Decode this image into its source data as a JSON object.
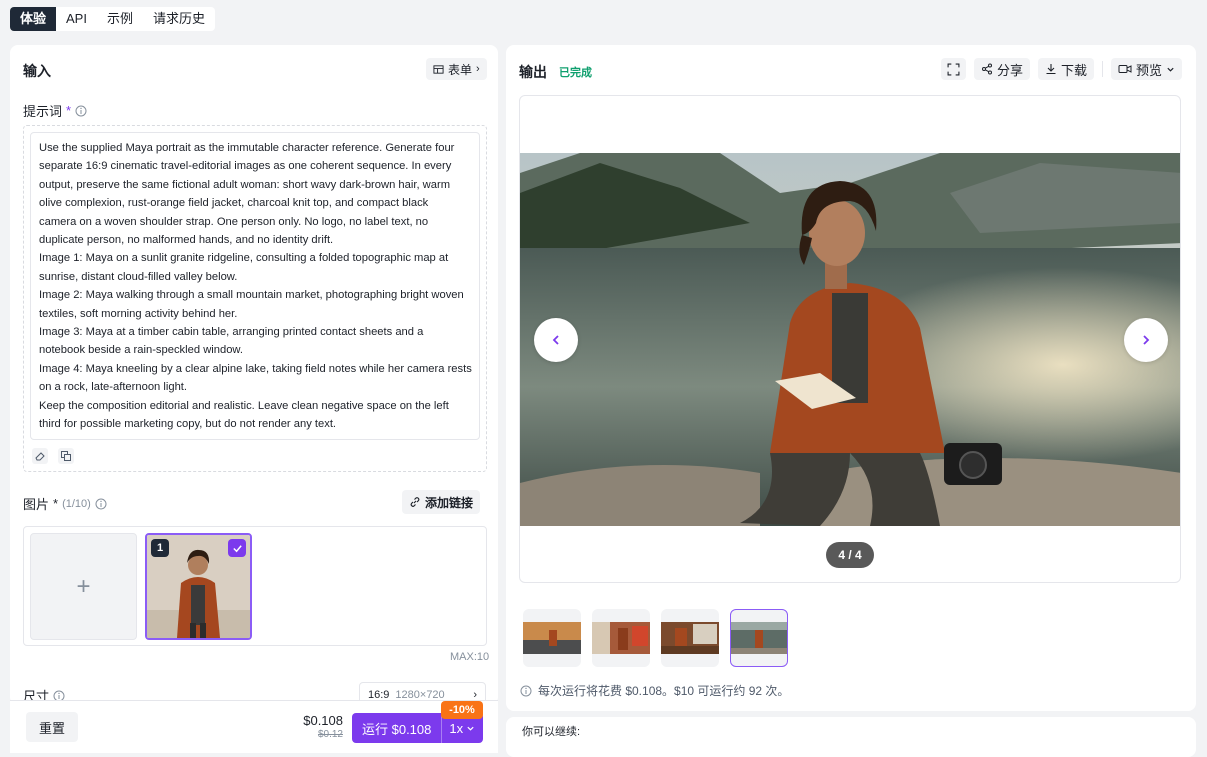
{
  "tabs": [
    "体验",
    "API",
    "示例",
    "请求历史"
  ],
  "input": {
    "title": "输入",
    "form_label": "表单",
    "prompt_label": "提示词",
    "required_mark": "*",
    "prompt_lines": [
      "Use the supplied Maya portrait as the immutable character reference. Generate four",
      "separate 16:9 cinematic travel-editorial images as one coherent sequence. In every",
      "output, preserve the same fictional adult woman: short wavy dark-brown hair, warm",
      "olive complexion, rust-orange field jacket, charcoal knit top, and compact black",
      "camera on a woven shoulder strap. One person only. No logo, no label text, no",
      "duplicate person, no malformed hands, and no identity drift.",
      "Image 1: Maya on a sunlit granite ridgeline, consulting a folded topographic map at",
      "sunrise, distant cloud-filled valley below.",
      "Image 2: Maya walking through a small mountain market, photographing bright woven",
      "textiles, soft morning activity behind her.",
      "Image 3: Maya at a timber cabin table, arranging printed contact sheets and a",
      "notebook beside a rain-speckled window.",
      "Image 4: Maya kneeling by a clear alpine lake, taking field notes while her camera rests",
      "on a rock, late-afternoon light.",
      "Keep the composition editorial and realistic. Leave clean negative space on the left",
      "third for possible marketing copy, but do not render any text."
    ],
    "image_label": "图片",
    "image_count": "(1/10)",
    "add_link_label": "添加链接",
    "thumb_number": "1",
    "max_label": "MAX:10",
    "size_label": "尺寸",
    "size_ratio": "16:9",
    "size_dims": "1280×720"
  },
  "footer": {
    "reset_label": "重置",
    "price": "$0.108",
    "old_price": "$0.12",
    "run_label": "运行 $0.108",
    "multiplier": "1x",
    "discount": "-10%"
  },
  "output": {
    "title": "输出",
    "status": "已完成",
    "share_label": "分享",
    "download_label": "下载",
    "preview_label": "预览",
    "counter": "4 / 4",
    "cost_note": "每次运行将花费 $0.108。$10 可运行约 92 次。",
    "continue_label": "你可以继续:"
  },
  "colors": {
    "accent": "#7c3aed",
    "status_green": "#0f9f6e",
    "discount_orange": "#f97316"
  }
}
